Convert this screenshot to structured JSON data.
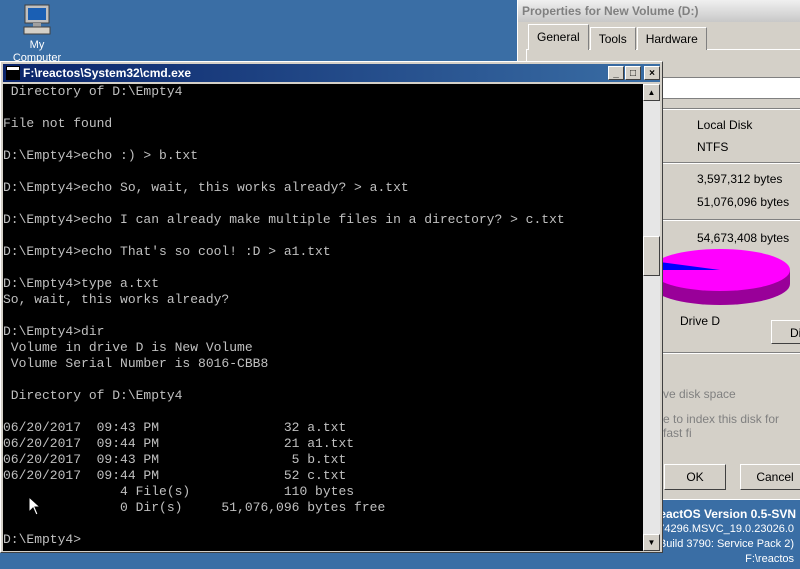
{
  "desktop": {
    "icon_label": "My Computer",
    "icon_name": "computer-icon"
  },
  "properties": {
    "title": "Properties for New Volume (D:)",
    "tabs": [
      "General",
      "Tools",
      "Hardware"
    ],
    "type_value": "Local Disk",
    "fs_value": "NTFS",
    "used_value": "3,597,312 bytes",
    "free_value": "51,076,096 bytes",
    "capacity_value": "54,673,408 bytes",
    "drive_label": "Drive D",
    "disk_button": "Di",
    "compress_text": "ve disk space",
    "index_text": "e to index this disk for fast fi",
    "ok": "OK",
    "cancel": "Cancel",
    "pie_colors": {
      "used": "#0000ff",
      "free": "#ff00ff"
    },
    "used_fraction": 0.066
  },
  "version": {
    "line1": "eactOS Version 0.5-SVN",
    "line2": "74296.MSVC_19.0.23026.0",
    "line3": "Build 3790: Service Pack 2)",
    "line4": "F:\\reactos"
  },
  "cmd": {
    "title": "F:\\reactos\\System32\\cmd.exe",
    "minimize": "_",
    "maximize": "□",
    "close": "×",
    "lines": [
      " Directory of D:\\Empty4",
      "",
      "File not found",
      "",
      "D:\\Empty4>echo :) > b.txt",
      "",
      "D:\\Empty4>echo So, wait, this works already? > a.txt",
      "",
      "D:\\Empty4>echo I can already make multiple files in a directory? > c.txt",
      "",
      "D:\\Empty4>echo That's so cool! :D > a1.txt",
      "",
      "D:\\Empty4>type a.txt",
      "So, wait, this works already?",
      "",
      "D:\\Empty4>dir",
      " Volume in drive D is New Volume",
      " Volume Serial Number is 8016-CBB8",
      "",
      " Directory of D:\\Empty4",
      "",
      "06/20/2017  09:43 PM                32 a.txt",
      "06/20/2017  09:44 PM                21 a1.txt",
      "06/20/2017  09:43 PM                 5 b.txt",
      "06/20/2017  09:44 PM                52 c.txt",
      "               4 File(s)            110 bytes",
      "               0 Dir(s)     51,076,096 bytes free",
      "",
      "D:\\Empty4>"
    ]
  }
}
